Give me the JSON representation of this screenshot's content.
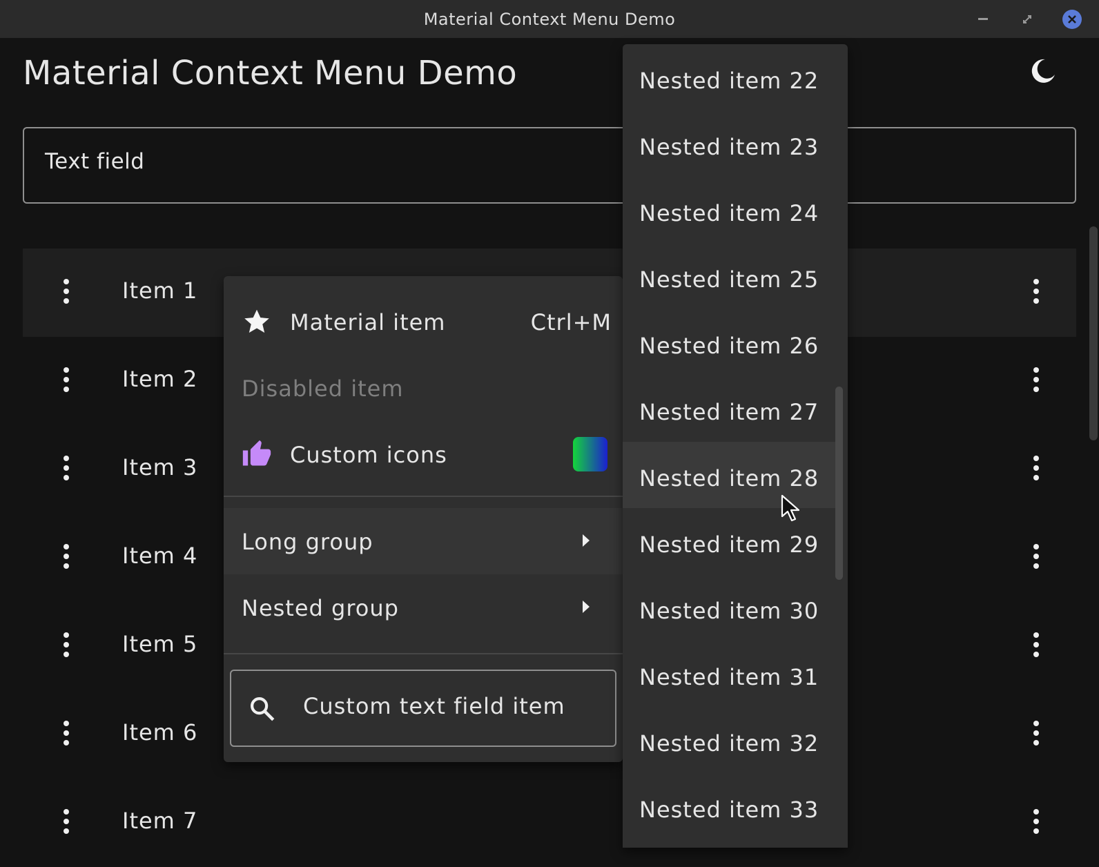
{
  "window": {
    "title": "Material Context Menu Demo"
  },
  "header": {
    "title": "Material Context Menu Demo"
  },
  "text_field": {
    "label": "Text field"
  },
  "list": {
    "items": [
      {
        "label": "Item 1"
      },
      {
        "label": "Item 2"
      },
      {
        "label": "Item 3"
      },
      {
        "label": "Item 4"
      },
      {
        "label": "Item 5"
      },
      {
        "label": "Item 6"
      },
      {
        "label": "Item 7"
      }
    ]
  },
  "context_menu": {
    "material_item": {
      "label": "Material item",
      "shortcut": "Ctrl+M",
      "icon": "star-icon"
    },
    "disabled_item": {
      "label": "Disabled item"
    },
    "custom_icons": {
      "label": "Custom icons",
      "icon": "thumbs-up-icon",
      "icon_color": "#c58af9"
    },
    "long_group": {
      "label": "Long group"
    },
    "nested_group": {
      "label": "Nested group"
    },
    "search_field": {
      "label": "Custom text field item",
      "icon": "search-icon"
    }
  },
  "submenu": {
    "items": [
      {
        "label": "Nested item 22"
      },
      {
        "label": "Nested item 23"
      },
      {
        "label": "Nested item 24"
      },
      {
        "label": "Nested item 25"
      },
      {
        "label": "Nested item 26"
      },
      {
        "label": "Nested item 27"
      },
      {
        "label": "Nested item 28"
      },
      {
        "label": "Nested item 29"
      },
      {
        "label": "Nested item 30"
      },
      {
        "label": "Nested item 31"
      },
      {
        "label": "Nested item 32"
      },
      {
        "label": "Nested item 33"
      }
    ],
    "hovered_index": 6
  }
}
